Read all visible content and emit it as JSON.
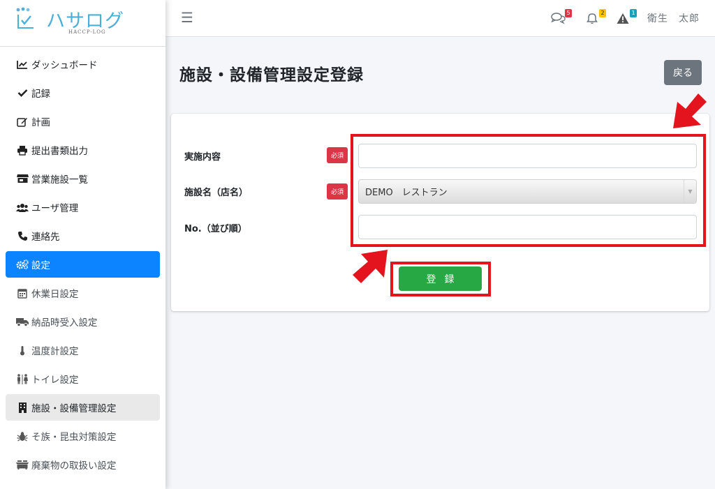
{
  "brand": {
    "name": "ハサログ",
    "sub": "HACCP-LOG"
  },
  "sidebar": {
    "items": [
      {
        "label": "ダッシュボード",
        "icon": "chart-line-icon"
      },
      {
        "label": "記録",
        "icon": "check-icon"
      },
      {
        "label": "計画",
        "icon": "edit-icon"
      },
      {
        "label": "提出書類出力",
        "icon": "printer-icon"
      },
      {
        "label": "営業施設一覧",
        "icon": "store-icon"
      },
      {
        "label": "ユーザ管理",
        "icon": "users-icon"
      },
      {
        "label": "連絡先",
        "icon": "phone-icon"
      },
      {
        "label": "設定",
        "icon": "cogs-icon"
      },
      {
        "label": "休業日設定",
        "icon": "calendar-icon"
      },
      {
        "label": "納品時受入設定",
        "icon": "truck-icon"
      },
      {
        "label": "温度計設定",
        "icon": "thermometer-icon"
      },
      {
        "label": "トイレ設定",
        "icon": "restroom-icon"
      },
      {
        "label": "施設・設備管理設定",
        "icon": "building-icon"
      },
      {
        "label": "そ族・昆虫対策設定",
        "icon": "bug-icon"
      },
      {
        "label": "廃棄物の取扱い設定",
        "icon": "dumpster-icon"
      }
    ]
  },
  "header": {
    "comments_count": "5",
    "notifications_count": "2",
    "alerts_count": "1",
    "user_name": "衛生　太郎"
  },
  "page": {
    "title": "施設・設備管理設定登録",
    "back_label": "戻る"
  },
  "form": {
    "required_label": "必須",
    "content_label": "実施内容",
    "content_value": "",
    "facility_label": "施設名（店名）",
    "facility_value": "DEMO　レストラン",
    "order_label": "No.（並び順）",
    "order_value": "",
    "submit_label": "登録"
  },
  "colors": {
    "accent": "#0d84ff",
    "success": "#28a745",
    "danger": "#dc3545",
    "highlight": "#e3141e"
  }
}
